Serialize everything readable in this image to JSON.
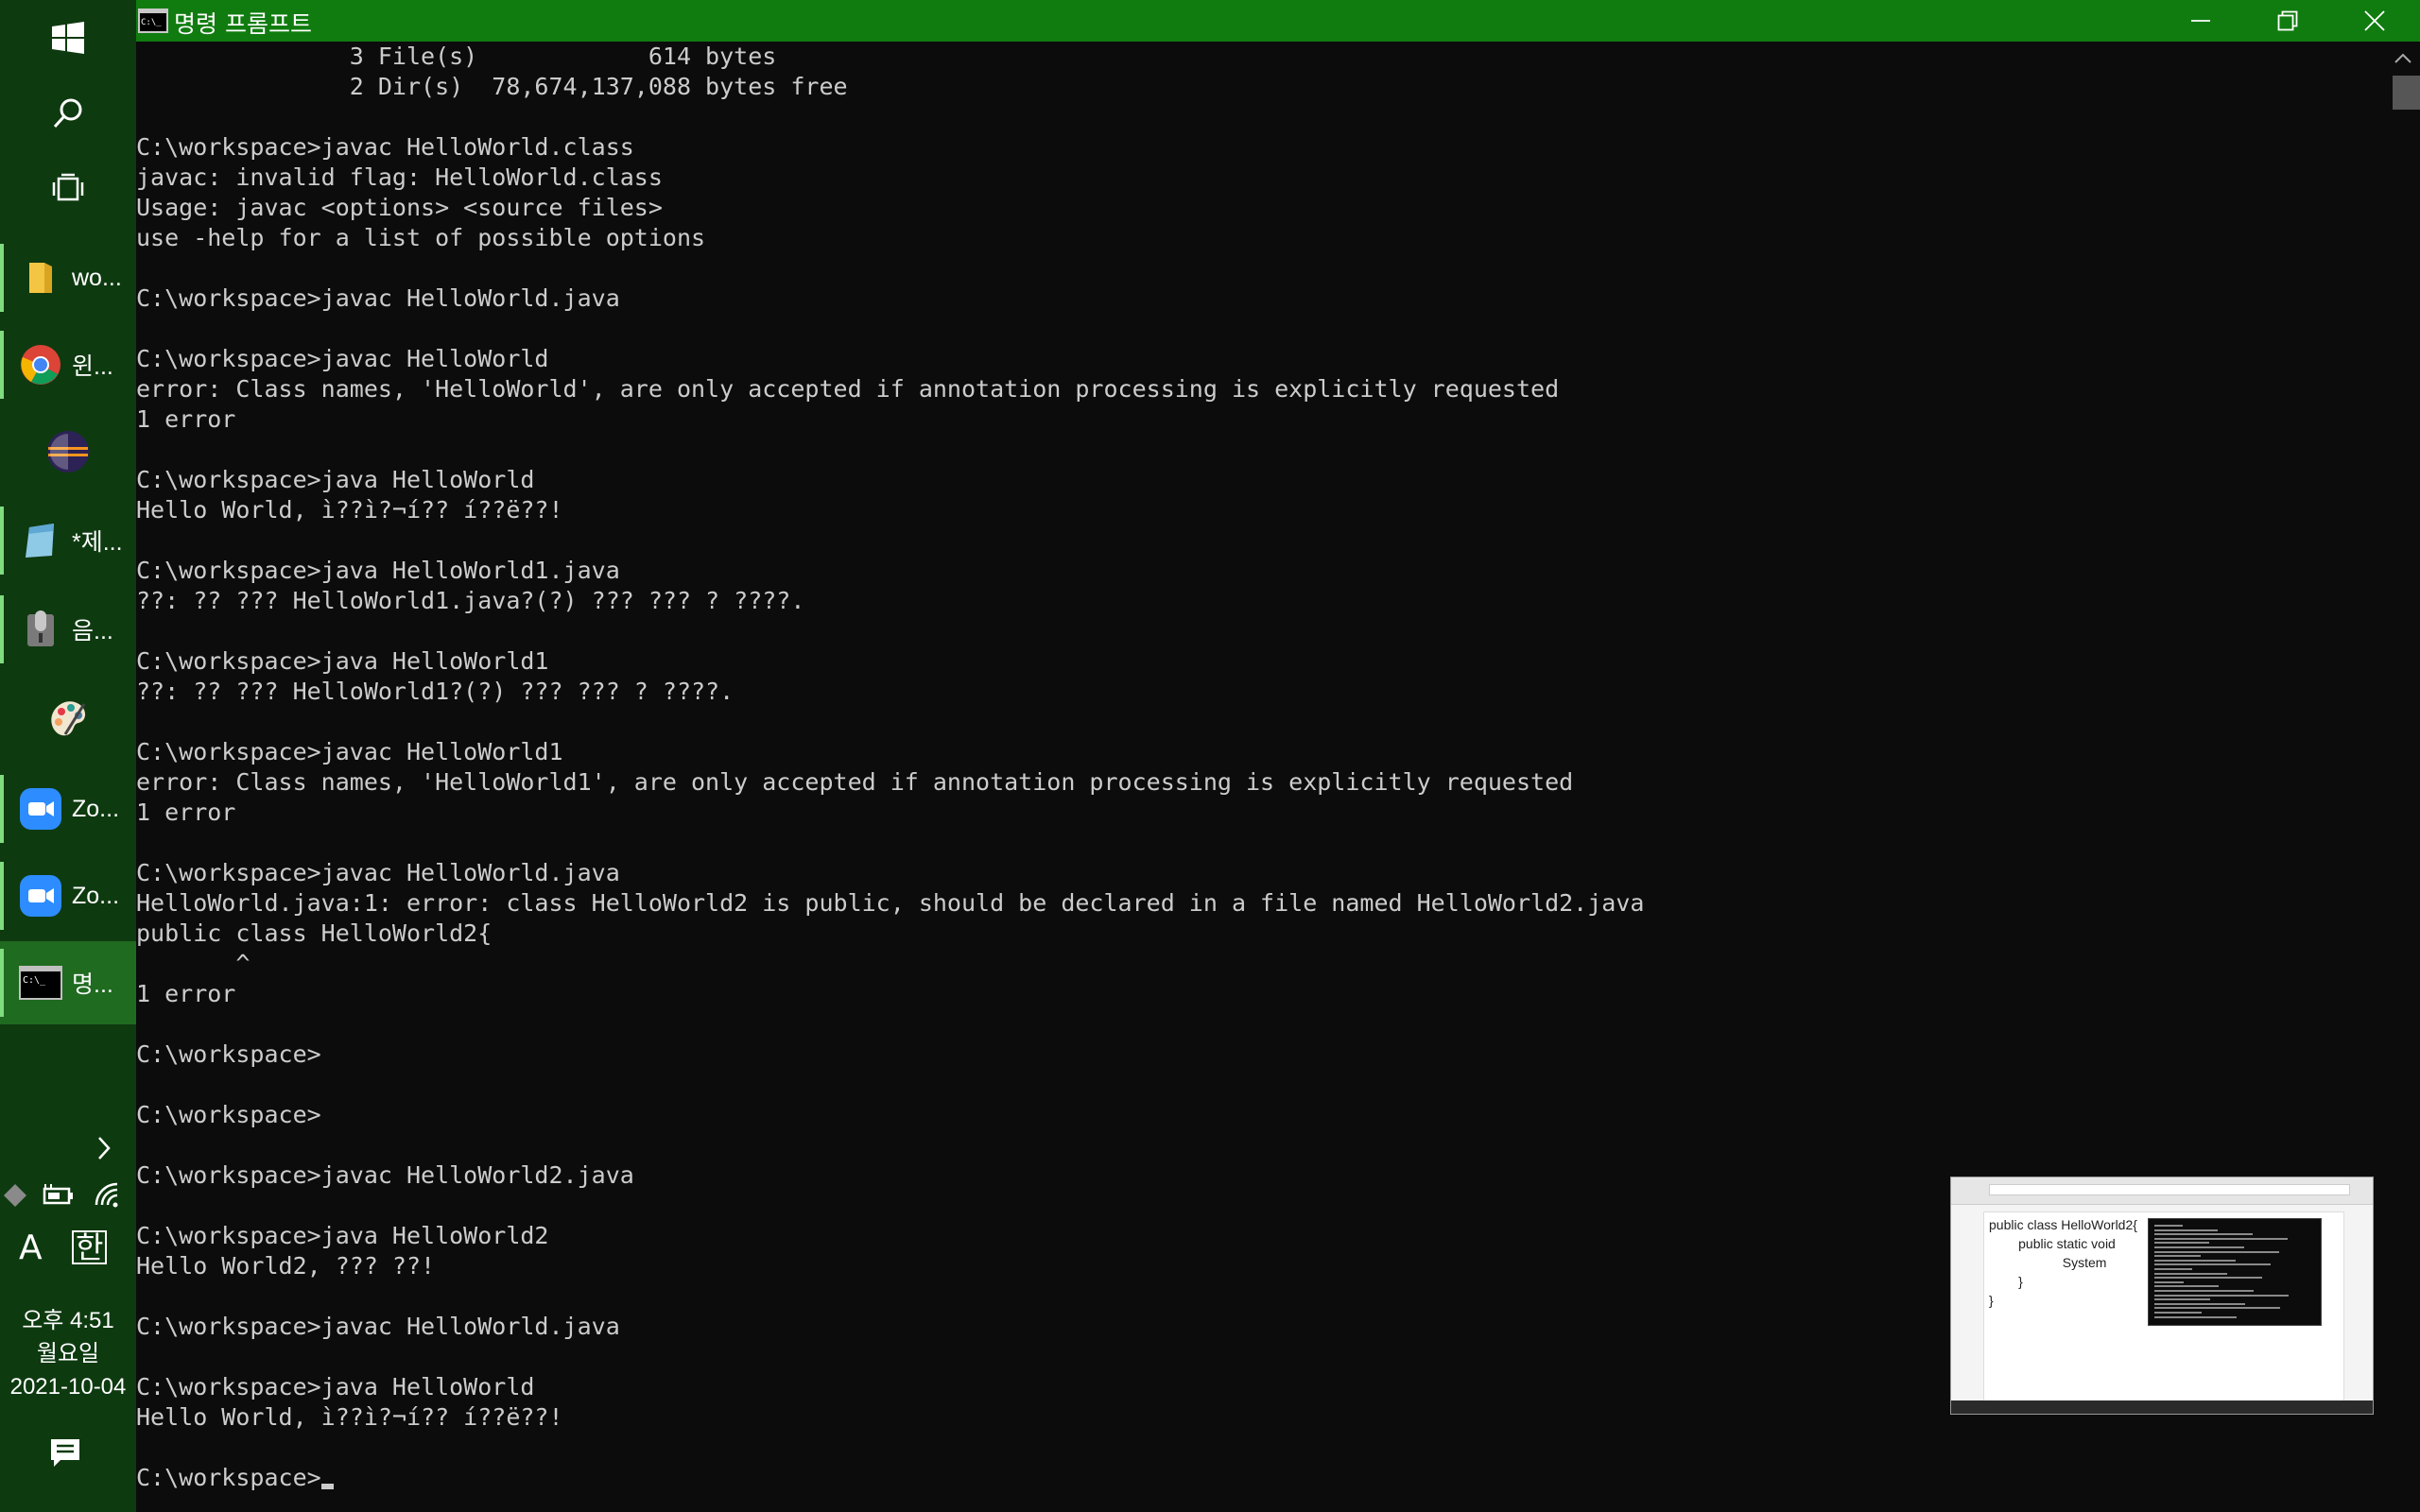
{
  "window": {
    "title": "명령 프롬프트",
    "controls": [
      "minimize-icon",
      "restore-icon",
      "close-icon"
    ]
  },
  "console": {
    "lines": [
      "               3 File(s)            614 bytes",
      "               2 Dir(s)  78,674,137,088 bytes free",
      "",
      "C:\\workspace>javac HelloWorld.class",
      "javac: invalid flag: HelloWorld.class",
      "Usage: javac <options> <source files>",
      "use -help for a list of possible options",
      "",
      "C:\\workspace>javac HelloWorld.java",
      "",
      "C:\\workspace>javac HelloWorld",
      "error: Class names, 'HelloWorld', are only accepted if annotation processing is explicitly requested",
      "1 error",
      "",
      "C:\\workspace>java HelloWorld",
      "Hello World, ì??ì?¬í?? í??ë??!",
      "",
      "C:\\workspace>java HelloWorld1.java",
      "??: ?? ??? HelloWorld1.java?(?) ??? ??? ? ????.",
      "",
      "C:\\workspace>java HelloWorld1",
      "??: ?? ??? HelloWorld1?(?) ??? ??? ? ????.",
      "",
      "C:\\workspace>javac HelloWorld1",
      "error: Class names, 'HelloWorld1', are only accepted if annotation processing is explicitly requested",
      "1 error",
      "",
      "C:\\workspace>javac HelloWorld.java",
      "HelloWorld.java:1: error: class HelloWorld2 is public, should be declared in a file named HelloWorld2.java",
      "public class HelloWorld2{",
      "       ^",
      "1 error",
      "",
      "C:\\workspace>",
      "",
      "C:\\workspace>",
      "",
      "C:\\workspace>javac HelloWorld2.java",
      "",
      "C:\\workspace>java HelloWorld2",
      "Hello World2, ??? ??!",
      "",
      "C:\\workspace>javac HelloWorld.java",
      "",
      "C:\\workspace>java HelloWorld",
      "Hello World, ì??ì?¬í?? í??ë??!",
      ""
    ],
    "prompt": "C:\\workspace>"
  },
  "taskbar": {
    "apps": [
      {
        "label": "wo...",
        "icon": "folder-icon"
      },
      {
        "label": "윈...",
        "icon": "chrome-icon"
      },
      {
        "label": "",
        "icon": "eclipse-icon"
      },
      {
        "label": "*제...",
        "icon": "notepad-icon"
      },
      {
        "label": "음...",
        "icon": "voice-recorder-icon"
      },
      {
        "label": "",
        "icon": "paint-icon"
      },
      {
        "label": "Zo...",
        "icon": "zoom-icon"
      },
      {
        "label": "Zo...",
        "icon": "zoom-icon"
      },
      {
        "label": "명...",
        "icon": "cmd-icon"
      }
    ],
    "ime_mode": "A",
    "ime_lang": "한",
    "clock": {
      "time": "오후 4:51",
      "day": "월요일",
      "date": "2021-10-04"
    }
  },
  "preview": {
    "code_lines": [
      "public class HelloWorld2{",
      "        public static void",
      "                    System",
      "        }",
      "}"
    ]
  },
  "colors": {
    "titlebar": "#107c10",
    "console_bg": "#0c0c0c",
    "console_text": "#cccccc",
    "taskbar_bg": "#0e3a10"
  }
}
